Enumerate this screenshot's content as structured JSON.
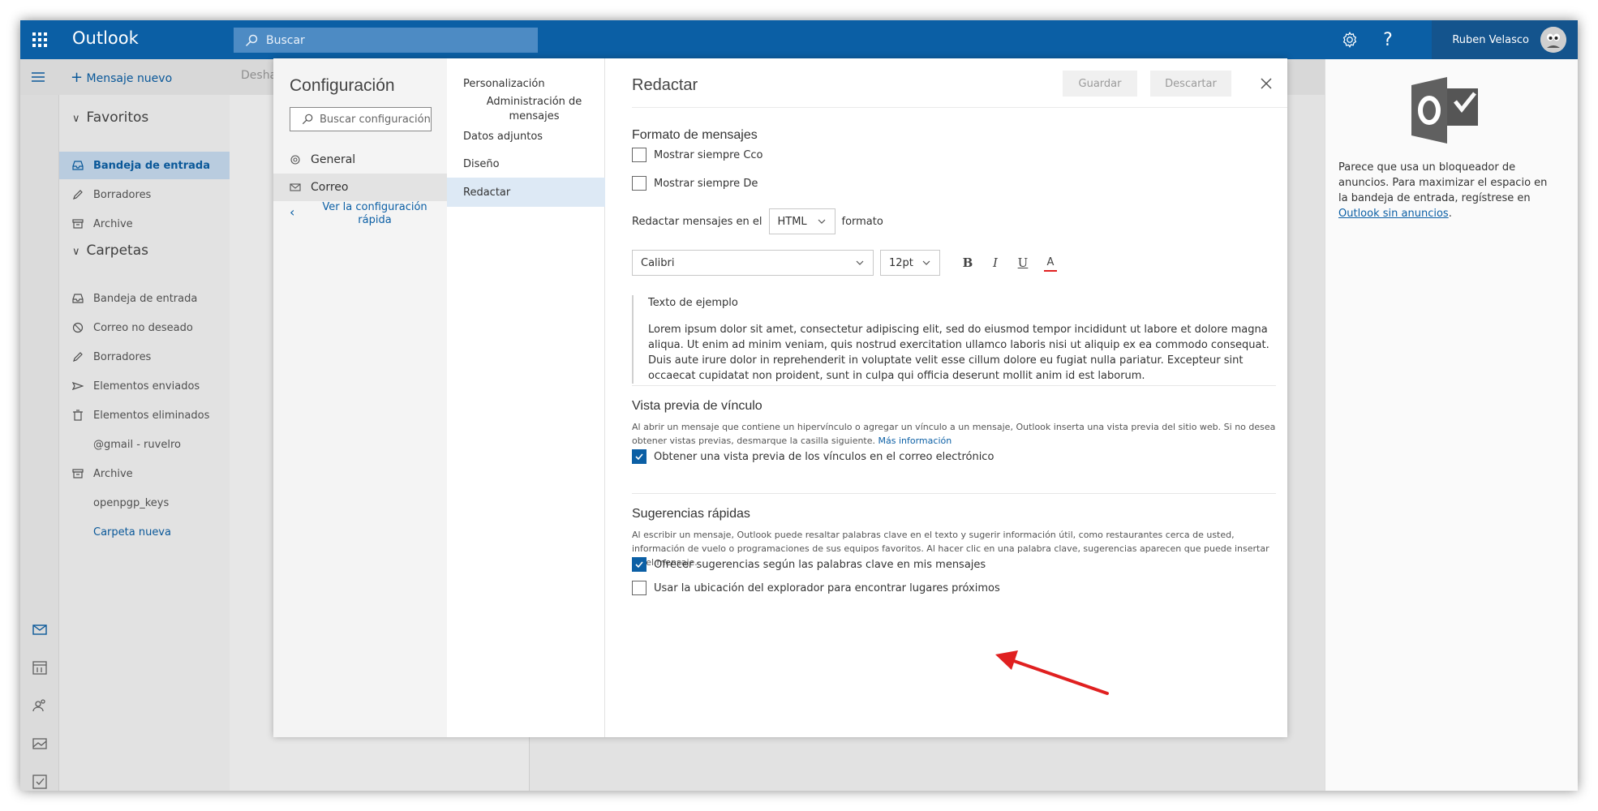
{
  "topbar": {
    "app_name": "Outlook",
    "search_placeholder": "Buscar",
    "user_name": "Ruben Velasco",
    "settings_icon": "gear-icon",
    "help_icon": "question-icon"
  },
  "commandbar": {
    "new_message": "Mensaje nuevo",
    "undo": "Desha"
  },
  "folders": {
    "favorites_header": "Favoritos",
    "favorites": [
      {
        "label": "Bandeja de entrada",
        "icon": "inbox-icon",
        "active": true
      },
      {
        "label": "Borradores",
        "icon": "pencil-icon"
      },
      {
        "label": "Archive",
        "icon": "archive-icon"
      }
    ],
    "folders_header": "Carpetas",
    "items": [
      {
        "label": "Bandeja de entrada",
        "icon": "inbox-icon"
      },
      {
        "label": "Correo no deseado",
        "icon": "block-icon"
      },
      {
        "label": "Borradores",
        "icon": "pencil-icon"
      },
      {
        "label": "Elementos enviados",
        "icon": "send-icon"
      },
      {
        "label": "Elementos eliminados",
        "icon": "trash-icon"
      },
      {
        "label": "@gmail - ruvelro",
        "icon": ""
      },
      {
        "label": "Archive",
        "icon": "archive-icon"
      },
      {
        "label": "openpgp_keys",
        "icon": ""
      },
      {
        "label": "Carpeta nueva",
        "icon": "",
        "link": true
      }
    ]
  },
  "settings": {
    "title": "Configuración",
    "search_placeholder": "Buscar configuración",
    "nav": [
      {
        "label": "General",
        "icon": "gear-icon"
      },
      {
        "label": "Correo",
        "icon": "mail-icon",
        "active": true
      }
    ],
    "quick_settings": "Ver la configuración rápida",
    "subnav": [
      {
        "label": "Personalización"
      },
      {
        "label": "Administración de mensajes"
      },
      {
        "label": "Datos adjuntos"
      },
      {
        "label": "Diseño"
      },
      {
        "label": "Redactar",
        "active": true
      }
    ]
  },
  "compose": {
    "title": "Redactar",
    "save": "Guardar",
    "discard": "Descartar",
    "format_section": "Formato de mensajes",
    "always_bcc": "Mostrar siempre Cco",
    "always_from": "Mostrar siempre De",
    "compose_in_prefix": "Redactar mensajes en el",
    "compose_format": "HTML",
    "compose_in_suffix": "formato",
    "font_name": "Calibri",
    "font_size": "12pt",
    "bold": "B",
    "italic": "I",
    "underline": "U",
    "font_color": "A",
    "sample_title": "Texto de ejemplo",
    "sample_text": "Lorem ipsum dolor sit amet, consectetur adipiscing elit, sed do eiusmod tempor incididunt ut labore et dolore magna aliqua. Ut enim ad minim veniam, quis nostrud exercitation ullamco laboris nisi ut aliquip ex ea commodo consequat. Duis aute irure dolor in reprehenderit in voluptate velit esse cillum dolore eu fugiat nulla pariatur. Excepteur sint occaecat cupidatat non proident, sunt in culpa qui officia deserunt mollit anim id est laborum.",
    "link_preview_section": "Vista previa de vínculo",
    "link_preview_desc": "Al abrir un mensaje que contiene un hipervínculo o agregar un vínculo a un mensaje, Outlook inserta una vista previa del sitio web. Si no desea obtener vistas previas, desmarque la casilla siguiente.",
    "more_info": "Más información",
    "link_preview_check": "Obtener una vista previa de los vínculos en el correo electrónico",
    "suggestions_section": "Sugerencias rápidas",
    "suggestions_desc": "Al escribir un mensaje, Outlook puede resaltar palabras clave en el texto y sugerir información útil, como restaurantes cerca de usted, información de vuelo o programaciones de sus equipos favoritos. Al hacer clic en una palabra clave, sugerencias aparecen que puede insertar en el mensaje.",
    "suggestions_check": "Ofrecer sugerencias según las palabras clave en mis mensajes",
    "location_check": "Usar la ubicación del explorador para encontrar lugares próximos"
  },
  "ad": {
    "text": "Parece que usa un bloqueador de anuncios. Para maximizar el espacio en la bandeja de entrada, regístrese en",
    "link": "Outlook sin anuncios",
    "end": "."
  },
  "colors": {
    "brand": "#0b5fa5",
    "annotation_arrow": "#e02020"
  }
}
